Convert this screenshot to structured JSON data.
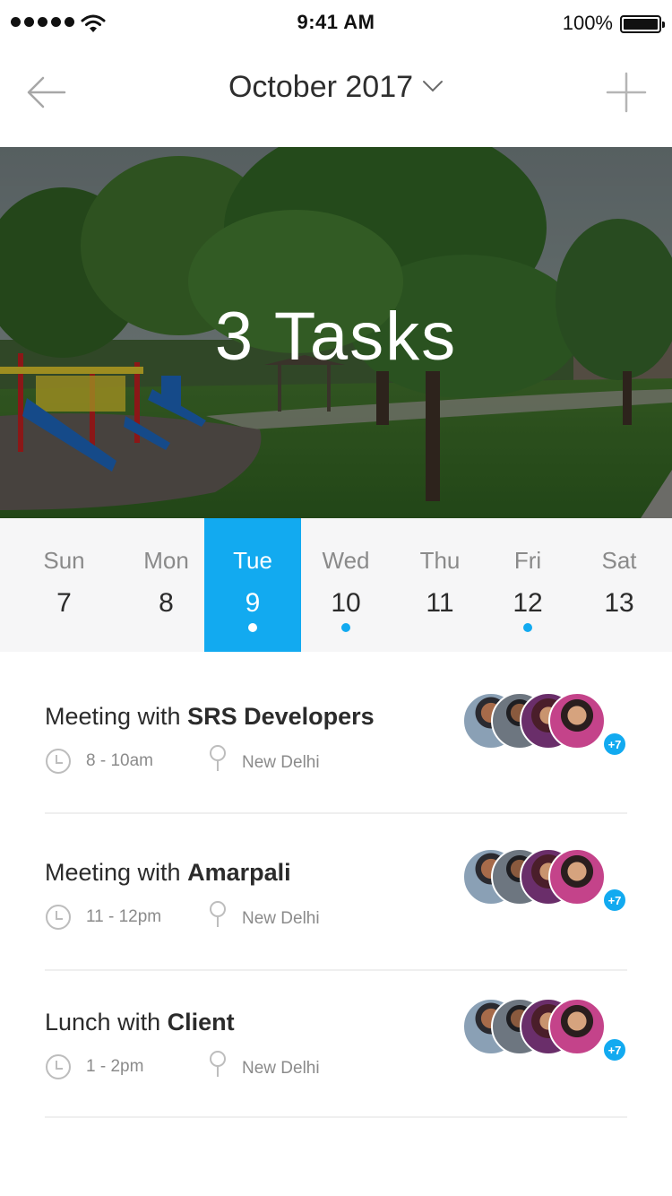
{
  "status_bar": {
    "time": "9:41 AM",
    "battery": "100%",
    "signal_icon": "cellular-signal-icon",
    "wifi_icon": "wifi-icon",
    "battery_icon": "battery-icon"
  },
  "header": {
    "month": "October 2017",
    "back_icon": "arrow-left-icon",
    "add_icon": "plus-icon",
    "dropdown_icon": "chevron-down-icon"
  },
  "hero": {
    "title": "3 Tasks"
  },
  "week": {
    "days": [
      {
        "name": "Sun",
        "date": "7",
        "selected": false,
        "has_event": false
      },
      {
        "name": "Mon",
        "date": "8",
        "selected": false,
        "has_event": false
      },
      {
        "name": "Tue",
        "date": "9",
        "selected": true,
        "has_event": true
      },
      {
        "name": "Wed",
        "date": "10",
        "selected": false,
        "has_event": true
      },
      {
        "name": "Thu",
        "date": "11",
        "selected": false,
        "has_event": false
      },
      {
        "name": "Fri",
        "date": "12",
        "selected": false,
        "has_event": true
      },
      {
        "name": "Sat",
        "date": "13",
        "selected": false,
        "has_event": false
      }
    ]
  },
  "tasks": [
    {
      "prefix": "Meeting with ",
      "subject": "SRS Developers",
      "time": "8 - 10am",
      "location": "New Delhi",
      "more": "+7"
    },
    {
      "prefix": "Meeting with ",
      "subject": "Amarpali",
      "time": "11 - 12pm",
      "location": "New Delhi",
      "more": "+7"
    },
    {
      "prefix": "Lunch with ",
      "subject": "Client",
      "time": "1 - 2pm",
      "location": "New Delhi",
      "more": "+7"
    }
  ],
  "colors": {
    "accent": "#12aaf0",
    "strip_bg": "#f6f6f7",
    "muted_text": "#8b8b8b"
  }
}
